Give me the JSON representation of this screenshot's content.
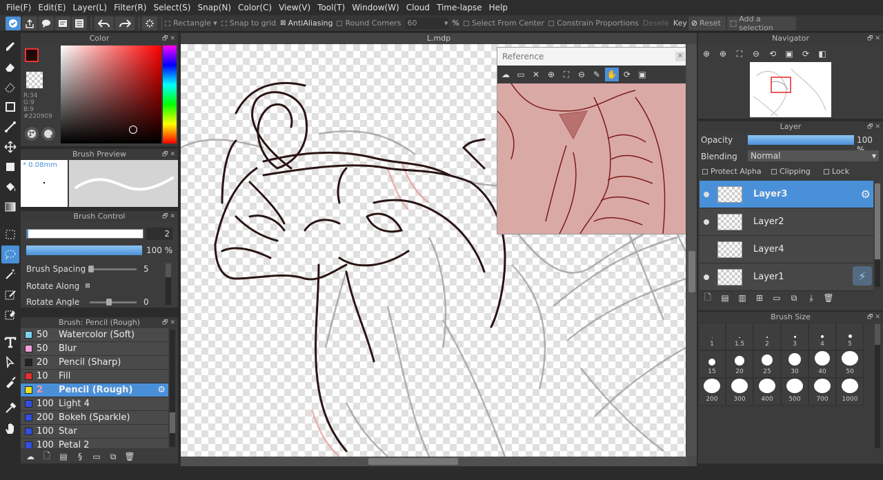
{
  "menu": [
    "File(F)",
    "Edit(E)",
    "Layer(L)",
    "Filter(R)",
    "Select(S)",
    "Snap(N)",
    "Color(C)",
    "View(V)",
    "Tool(T)",
    "Window(W)",
    "Cloud",
    "Time-lapse",
    "Help"
  ],
  "toolbar": {
    "shape": "Rectangle",
    "snap_to_grid": "Snap to grid",
    "antialiasing": "AntiAliasing",
    "round_corners": "Round Corners",
    "round_value": "60",
    "percent": "%",
    "select_from_center": "Select From Center",
    "constrain_proportions": "Constrain Proportions",
    "deselect": "Deselec",
    "key": "Key",
    "reset": "Reset",
    "add_selection": "Add a selection"
  },
  "color_panel": {
    "title": "Color",
    "r": "R:34",
    "g": "G:9",
    "b": "B:9",
    "hex": "#220909",
    "current": "#220909"
  },
  "brush_preview": {
    "title": "Brush Preview",
    "size": "* 0.08mm"
  },
  "brush_control": {
    "title": "Brush Control",
    "size_value": "2",
    "opacity_value": "100 %",
    "spacing_label": "Brush Spacing",
    "spacing_value": "5",
    "rotate_along": "Rotate Along",
    "rotate_angle": "Rotate Angle",
    "rotate_angle_value": "0"
  },
  "brush_list": {
    "title": "Brush: Pencil (Rough)",
    "items": [
      {
        "size": "50",
        "name": "Watercolor (Soft)",
        "color": "#7fd3f0"
      },
      {
        "size": "50",
        "name": "Blur",
        "color": "#f59fd8"
      },
      {
        "size": "20",
        "name": "Pencil (Sharp)",
        "color": "#222222"
      },
      {
        "size": "10",
        "name": "Fill",
        "color": "#e03030"
      },
      {
        "size": "2",
        "name": "Pencil (Rough)",
        "color": "#e8e020"
      },
      {
        "size": "100",
        "name": "Light 4",
        "color": "#3050e0"
      },
      {
        "size": "200",
        "name": "Bokeh (Sparkle)",
        "color": "#3050e0"
      },
      {
        "size": "100",
        "name": "Star",
        "color": "#3050e0"
      },
      {
        "size": "100",
        "name": "Petal 2",
        "color": "#3050e0"
      }
    ]
  },
  "canvas": {
    "title": "L.mdp"
  },
  "reference": {
    "title": "Reference"
  },
  "navigator": {
    "title": "Navigator"
  },
  "layer_panel": {
    "title": "Layer",
    "opacity_label": "Opacity",
    "opacity_value": "100 %",
    "opacity_level": 1.0,
    "blending_label": "Blending",
    "blending_value": "Normal",
    "protect_alpha": "Protect Alpha",
    "clipping": "Clipping",
    "lock": "Lock",
    "layers": [
      {
        "name": "Layer3",
        "visible": true
      },
      {
        "name": "Layer2",
        "visible": true
      },
      {
        "name": "Layer4",
        "visible": false
      },
      {
        "name": "Layer1",
        "visible": true
      }
    ]
  },
  "brush_size": {
    "title": "Brush Size",
    "sizes": [
      "1",
      "1.5",
      "2",
      "3",
      "4",
      "5",
      "15",
      "20",
      "25",
      "30",
      "40",
      "50",
      "200",
      "300",
      "400",
      "500",
      "700",
      "1000"
    ]
  },
  "colors": {
    "accent": "#4a90d9",
    "reference_bg": "#d9a9a6"
  }
}
